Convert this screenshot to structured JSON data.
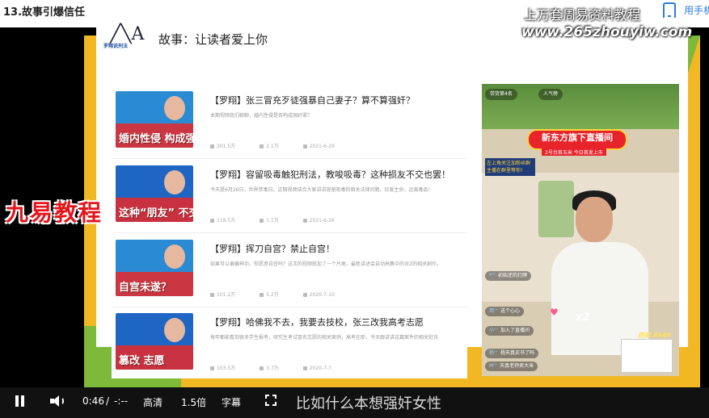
{
  "page": {
    "title": "13.故事引爆信任",
    "mobile_link": "用手机"
  },
  "watermark": {
    "line1": "上万套周易资料教程",
    "line2": "www.265zhouyiw.com"
  },
  "overlay_brand": "九易教程",
  "slide": {
    "heading": "故事：让读者爱上你",
    "logo_glyph": "╱╲A",
    "logo_sub": "罗翔说刑法"
  },
  "articles": [
    {
      "thumb_text": "婚内性侵 构成强奸罪吗",
      "thumb_color": "#2a8bd4",
      "title": "【罗翔】张三冒充歹徒强暴自己妻子？算不算强奸？",
      "desc": "本期视频我们聊聊，婚内性侵是否构成强奸罪？",
      "views": "201.5万",
      "comments": "2.1万",
      "date": "2021-6-29"
    },
    {
      "thumb_text": "这种“朋友” 不交也罢！",
      "thumb_color": "#1f66c4",
      "title": "【罗翔】容留吸毒触犯刑法，教唆吸毒？这种损友不交也罢！",
      "desc": "今天是6月26日，世界禁毒日。这期视频结合大家讲讲容留吸毒的相关法律问题。珍爱生命，远离毒品！",
      "views": "118.5万",
      "comments": "1.1万",
      "date": "2021-6-26"
    },
    {
      "thumb_text": "自宫未遂？",
      "thumb_color": "#2a8bd4",
      "title": "【罗翔】挥刀自宫？禁止自宫！",
      "desc": "如果可以偏偏神功，你愿意自宫吗？这次的视频就加了一个片尾，最新讲述会自动高集中的对Z的相关剧作。",
      "views": "101.2万",
      "comments": "5.2万",
      "date": "2020-7-10"
    },
    {
      "thumb_text": "篡改 志愿",
      "thumb_color": "#1f66c4",
      "title": "【罗翔】哈佛我不去，我要去技校，张三改我高考志愿",
      "desc": "每年都能看到很多学生报考，研究生考试冒名志愿的相关案例，高考在即，今天跟讲讲这篇案件的相关犯讯",
      "views": "103.5万",
      "comments": "3.7万",
      "date": "2020-7-7"
    }
  ],
  "live": {
    "top_left": "带货第4名",
    "top_mid": "人气榜",
    "banner": "新东方旗下直播间",
    "banner_sub": "2号台首玉米 今日首发上市",
    "tag": "左上角关注加粉丝群 主播在群里等你!",
    "heart_count": "x2",
    "sales": "热卖 4649",
    "comments": [
      {
        "user": "*'''",
        "text": "初始还的灯牌"
      },
      {
        "user": "用'''",
        "text": "送个心心"
      },
      {
        "user": "小'''",
        "text": "加入了直播间"
      },
      {
        "user": "杨'''",
        "text": "杨天真买书了吗"
      },
      {
        "user": "M'''",
        "text": "天真老师卖大米"
      }
    ]
  },
  "controls": {
    "time_current": "0:46",
    "time_sep": "/",
    "time_total": "-:--",
    "quality": "高清",
    "speed": "1.5倍",
    "captions": "字幕",
    "subtitle_text": "比如什么本想强奸女性"
  }
}
